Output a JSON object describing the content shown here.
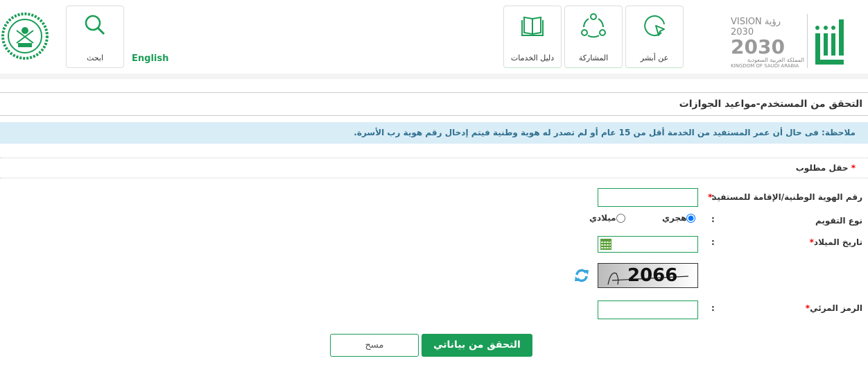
{
  "header": {
    "brand": "أبشر",
    "vision_text": "VISION رؤية 2030",
    "vision_sub_ar": "المملكة العربية السعودية",
    "vision_sub_en": "KINGDOM OF SAUDI ARABIA",
    "tiles": [
      {
        "label": "عن أبشر",
        "icon": "cursor-circle-icon"
      },
      {
        "label": "المشاركة",
        "icon": "share-nodes-icon"
      },
      {
        "label": "دليل الخدمات",
        "icon": "book-icon"
      }
    ],
    "language": "English",
    "search": {
      "label": "ابحث",
      "icon": "search-icon"
    }
  },
  "page": {
    "title": "التحقق من المستخدم-مواعيد الجوازات",
    "note": "ملاحظة: فى حال أن عمر المستفيد من الخدمة أقل من 15 عام أو لم تصدر له هوية وطنية فيتم إدخال رقم هوية رب الأسرة.",
    "required_note": "حقل مطلوب"
  },
  "form": {
    "id_label": "رقم الهوية الوطنية/الإقامة للمستفيد",
    "id_value": "",
    "calendar_label": "نوع التقويم",
    "calendar_options": [
      {
        "label": "هجري",
        "checked": true
      },
      {
        "label": "ميلادي",
        "checked": false
      }
    ],
    "dob_label": "تاريخ الميلاد",
    "dob_value": "",
    "captcha_text": "2066",
    "captcha_label": "الرمز المرئي",
    "captcha_value": "",
    "colon": ":",
    "star": "*"
  },
  "buttons": {
    "submit": "التحقق من بياناتي",
    "clear": "مسح"
  },
  "colors": {
    "accent": "#1a9d56",
    "note_bg": "#d9edf7"
  }
}
